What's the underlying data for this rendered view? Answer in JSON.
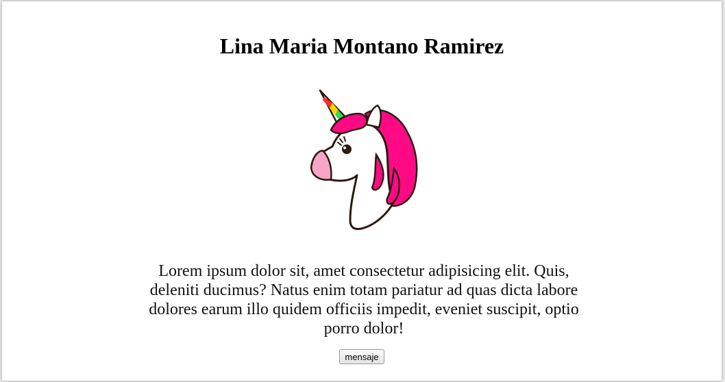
{
  "page": {
    "title": "Lina Maria Montano Ramirez",
    "paragraph": "Lorem ipsum dolor sit, amet consectetur adipisicing elit. Quis, deleniti ducimus? Natus enim totam pariatur ad quas dicta labore dolores earum illo quidem officiis impedit, eveniet suscipit, optio porro dolor!",
    "button_label": "mensaje"
  },
  "illustration": {
    "icon": "unicorn-icon",
    "colors": {
      "mane": "#ff0a84",
      "snout": "#f7a6c8",
      "outline": "#2a1a10",
      "horn": [
        "#ff2a2a",
        "#ffd200",
        "#3ad84a",
        "#2fa0ff"
      ]
    }
  }
}
